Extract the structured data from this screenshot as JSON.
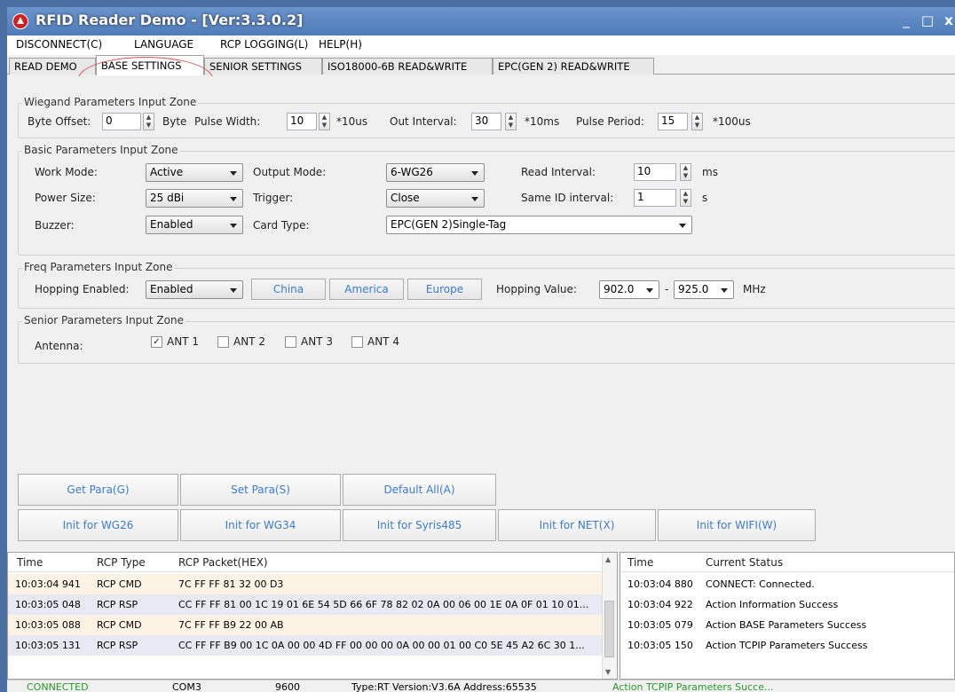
{
  "title": "RFID Reader Demo - [Ver:3.3.0.2]",
  "window_controls": {
    "minimize": "_",
    "maximize": "□",
    "close": "x"
  },
  "menu": [
    "DISCONNECT(C)",
    "LANGUAGE",
    "RCP LOGGING(L)",
    "HELP(H)"
  ],
  "tabs": [
    "READ DEMO",
    "BASE SETTINGS",
    "SENIOR SETTINGS",
    "ISO18000-6B READ&WRITE",
    "EPC(GEN 2) READ&WRITE"
  ],
  "wiegand": {
    "title": "Wiegand Parameters Input Zone",
    "byte_offset_label": "Byte Offset:",
    "byte_offset": "0",
    "byte_unit": "Byte",
    "pulse_width_label": "Pulse Width:",
    "pulse_width": "10",
    "pulse_width_unit": "*10us",
    "out_interval_label": "Out Interval:",
    "out_interval": "30",
    "out_interval_unit": "*10ms",
    "pulse_period_label": "Pulse Period:",
    "pulse_period": "15",
    "pulse_period_unit": "*100us"
  },
  "basic": {
    "title": "Basic Parameters Input Zone",
    "work_mode_label": "Work Mode:",
    "work_mode": "Active",
    "output_mode_label": "Output Mode:",
    "output_mode": "6-WG26",
    "read_interval_label": "Read Interval:",
    "read_interval": "10",
    "read_interval_unit": "ms",
    "power_size_label": "Power Size:",
    "power_size": "25 dBi",
    "trigger_label": "Trigger:",
    "trigger": "Close",
    "same_id_label": "Same ID interval:",
    "same_id": "1",
    "same_id_unit": "s",
    "buzzer_label": "Buzzer:",
    "buzzer": "Enabled",
    "card_type_label": "Card Type:",
    "card_type": "EPC(GEN 2)Single-Tag"
  },
  "freq": {
    "title": "Freq Parameters Input Zone",
    "hopping_enabled_label": "Hopping Enabled:",
    "hopping_enabled": "Enabled",
    "china": "China",
    "america": "America",
    "europe": "Europe",
    "hopping_value_label": "Hopping Value:",
    "freq_from": "902.0",
    "dash": "-",
    "freq_to": "925.0",
    "unit": "MHz"
  },
  "senior": {
    "title": "Senior Parameters Input Zone",
    "antenna_label": "Antenna:",
    "antennas": [
      {
        "label": "ANT 1",
        "checked": true
      },
      {
        "label": "ANT 2",
        "checked": false
      },
      {
        "label": "ANT 3",
        "checked": false
      },
      {
        "label": "ANT 4",
        "checked": false
      }
    ]
  },
  "buttons_row1": [
    "Get Para(G)",
    "Set Para(S)",
    "Default All(A)"
  ],
  "buttons_row2": [
    "Init for WG26",
    "Init for WG34",
    "Init for Syris485",
    "Init for NET(X)",
    "Init for WIFI(W)"
  ],
  "rcp_log": {
    "headers": [
      "Time",
      "RCP Type",
      "RCP Packet(HEX)"
    ],
    "rows": [
      {
        "time": "10:03:04 941",
        "type": "RCP CMD",
        "packet": "7C FF FF 81 32 00 D3",
        "bg": "#fdf3e4"
      },
      {
        "time": "10:03:05 048",
        "type": "RCP RSP",
        "packet": "CC FF FF 81 00 1C 19 01 6E 54 5D 66 6F 78 82 02 0A 00 06 00 1E 0A 0F 01 10 01...",
        "bg": "#e9e9f6"
      },
      {
        "time": "10:03:05 088",
        "type": "RCP CMD",
        "packet": "7C FF FF B9 22 00 AB",
        "bg": "#fdf3e4"
      },
      {
        "time": "10:03:05 131",
        "type": "RCP RSP",
        "packet": "CC FF FF B9 00 1C 0A 00 00 4D FF 00 00 00 0A 00 00 01 00 C0 5E 45 A2 6C 30 1...",
        "bg": "#e9e9f6"
      }
    ]
  },
  "status_log": {
    "headers": [
      "Time",
      "Current Status"
    ],
    "rows": [
      {
        "time": "10:03:04 880",
        "status": "CONNECT: Connected."
      },
      {
        "time": "10:03:04 922",
        "status": "Action Information Success"
      },
      {
        "time": "10:03:05 079",
        "status": "Action BASE Parameters Success"
      },
      {
        "time": "10:03:05 150",
        "status": "Action TCPIP Parameters Success"
      }
    ]
  },
  "statusbar": [
    "CONNECTED",
    "COM3",
    "9600",
    "Type:RT   Version:V3.6A   Address:65535",
    "Action TCPIP Parameters Succe..."
  ]
}
